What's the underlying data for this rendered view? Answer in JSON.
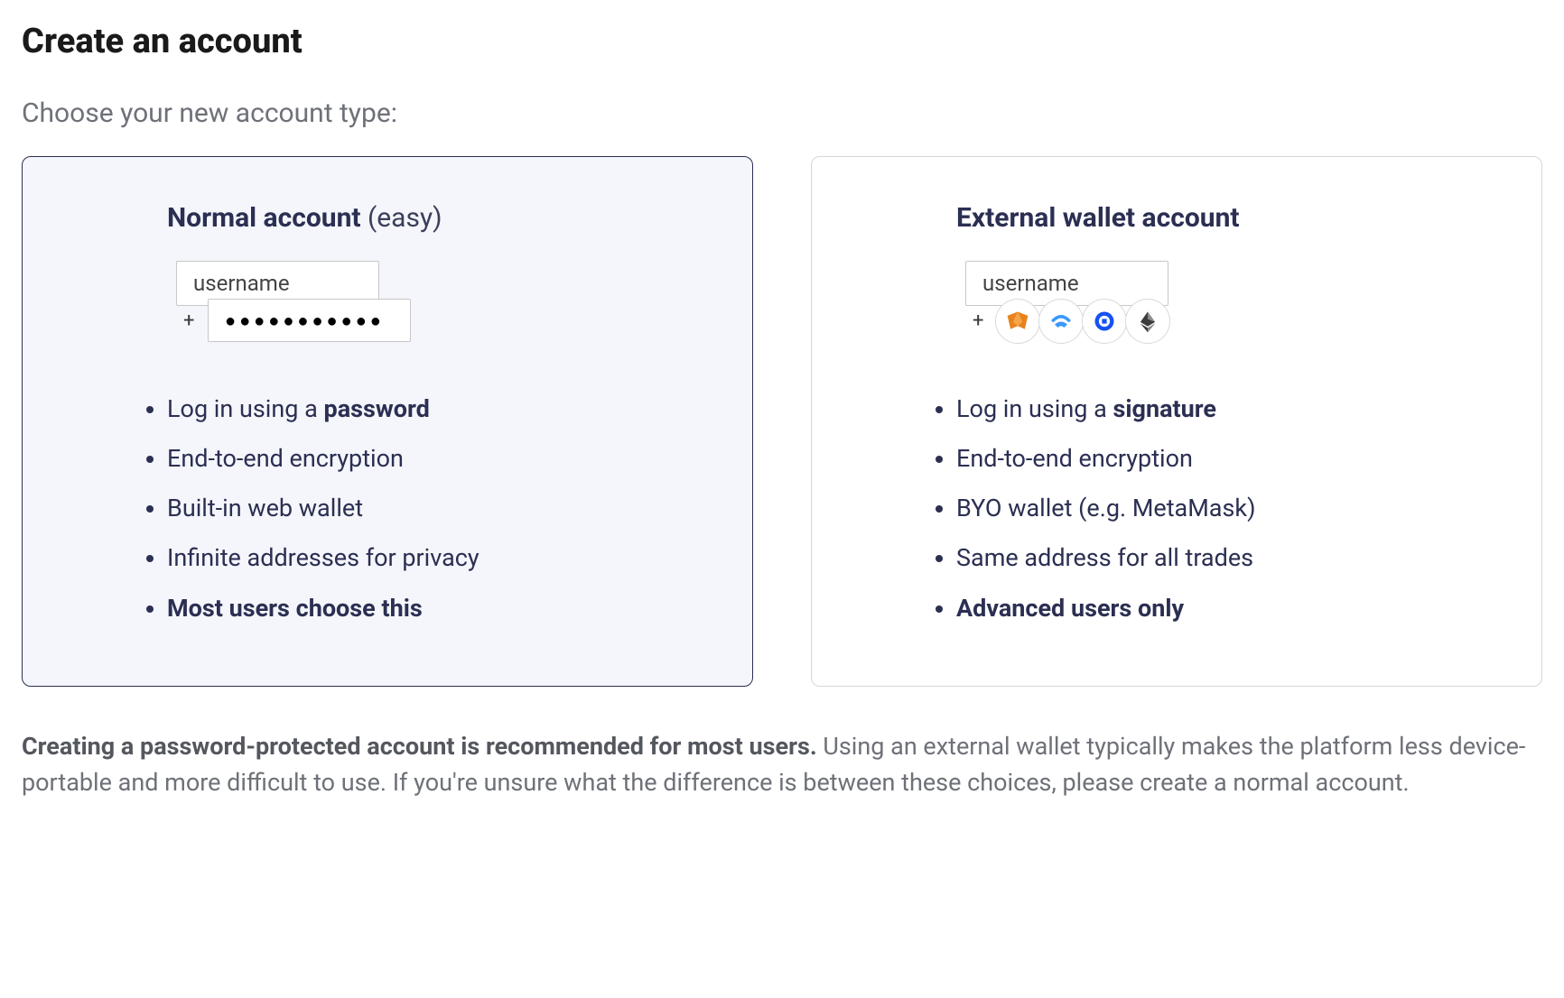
{
  "page": {
    "title": "Create an account",
    "subtitle": "Choose your new account type:"
  },
  "normal": {
    "title": "Normal account ",
    "title_suffix": "(easy)",
    "username_placeholder": "username",
    "password_dots": "●●●●●●●●●●●",
    "plus": "+",
    "features": [
      {
        "pre": "Log in using a ",
        "strong": "password",
        "post": ""
      },
      {
        "pre": "End-to-end encryption",
        "strong": "",
        "post": ""
      },
      {
        "pre": "Built-in web wallet",
        "strong": "",
        "post": ""
      },
      {
        "pre": "Infinite addresses for privacy",
        "strong": "",
        "post": ""
      },
      {
        "pre": "",
        "strong": "Most users choose this",
        "post": "",
        "bold": true
      }
    ]
  },
  "external": {
    "title": "External wallet account",
    "username_placeholder": "username",
    "plus": "+",
    "wallets": [
      "metamask",
      "walletconnect",
      "coinbase",
      "ethereum"
    ],
    "features": [
      {
        "pre": "Log in using a ",
        "strong": "signature",
        "post": ""
      },
      {
        "pre": "End-to-end encryption",
        "strong": "",
        "post": ""
      },
      {
        "pre": "BYO wallet (e.g. MetaMask)",
        "strong": "",
        "post": ""
      },
      {
        "pre": "Same address for all trades",
        "strong": "",
        "post": ""
      },
      {
        "pre": "",
        "strong": "Advanced users only",
        "post": "",
        "bold": true
      }
    ]
  },
  "footer": {
    "strong": "Creating a password-protected account is recommended for most users.",
    "rest": " Using an external wallet typically makes the platform less device-portable and more difficult to use. If you're unsure what the difference is between these choices, please create a normal account."
  }
}
